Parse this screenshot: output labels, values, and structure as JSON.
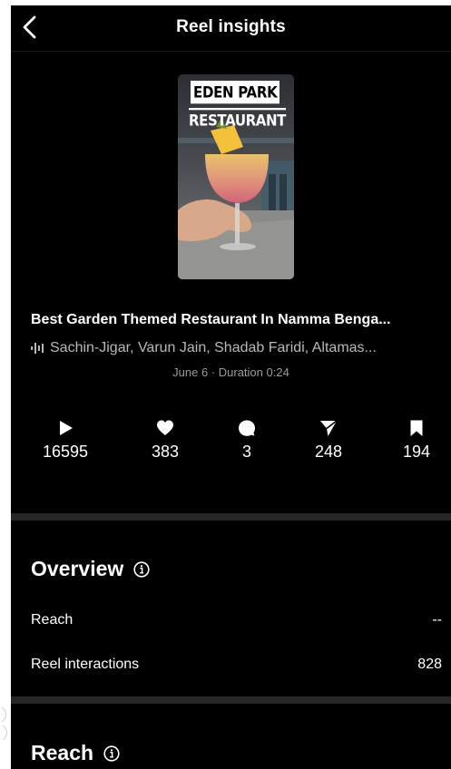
{
  "header": {
    "title": "Reel insights",
    "back_icon": "chevron-left-icon"
  },
  "reel": {
    "thumbnail_text_1": "EDEN PARK",
    "thumbnail_text_2": "RESTAURANT",
    "title": "Best Garden Themed Restaurant In Namma Benga...",
    "audio": "Sachin-Jigar, Varun Jain, Shadab Faridi, Altamas...",
    "meta": "June 6 · Duration 0:24"
  },
  "stats": {
    "plays": "16595",
    "likes": "383",
    "comments": "3",
    "shares": "248",
    "saves": "194"
  },
  "overview": {
    "title": "Overview",
    "rows": [
      {
        "label": "Reach",
        "value": "--"
      },
      {
        "label": "Reel interactions",
        "value": "828"
      }
    ]
  },
  "reach": {
    "title": "Reach"
  },
  "colors": {
    "background": "#000000",
    "text": "#ffffff",
    "muted_text": "#b8b8b8",
    "divider": "#262626"
  }
}
